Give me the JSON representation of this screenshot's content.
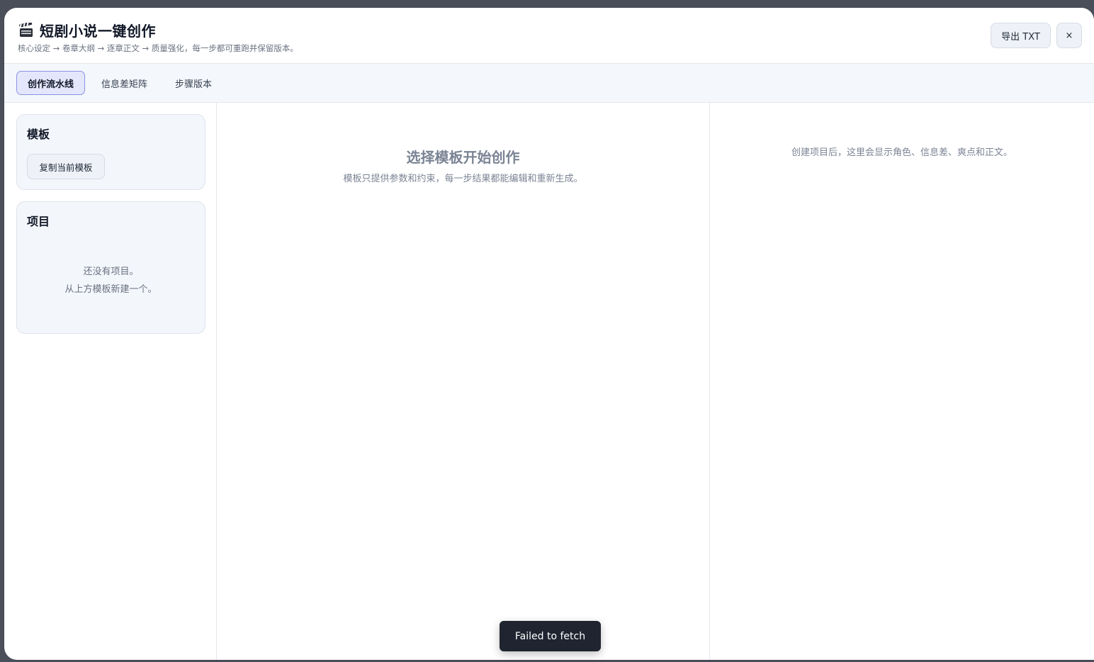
{
  "header": {
    "title": "短剧小说一键创作",
    "title_icon": "clapperboard-icon",
    "subtitle": "核心设定 → 卷章大纲 → 逐章正文 → 质量强化，每一步都可重跑并保留版本。",
    "export_label": "导出 TXT",
    "close_label": "×"
  },
  "tabs": [
    {
      "label": "创作流水线",
      "active": true
    },
    {
      "label": "信息差矩阵",
      "active": false
    },
    {
      "label": "步骤版本",
      "active": false
    }
  ],
  "sidebar": {
    "template_card": {
      "title": "模板",
      "copy_button": "复制当前模板"
    },
    "projects_card": {
      "title": "项目",
      "empty_line1": "还没有项目。",
      "empty_line2": "从上方模板新建一个。"
    }
  },
  "main": {
    "title": "选择模板开始创作",
    "subtitle": "模板只提供参数和约束，每一步结果都能编辑和重新生成。"
  },
  "right_panel": {
    "placeholder": "创建项目后，这里会显示角色、信息差、爽点和正文。"
  },
  "toast": {
    "message": "Failed to fetch"
  },
  "colors": {
    "accent_tab_bg": "#e4e7fb",
    "accent_tab_border": "#8b93e6",
    "toast_bg": "#1f2430",
    "muted_text": "#7b8494"
  }
}
